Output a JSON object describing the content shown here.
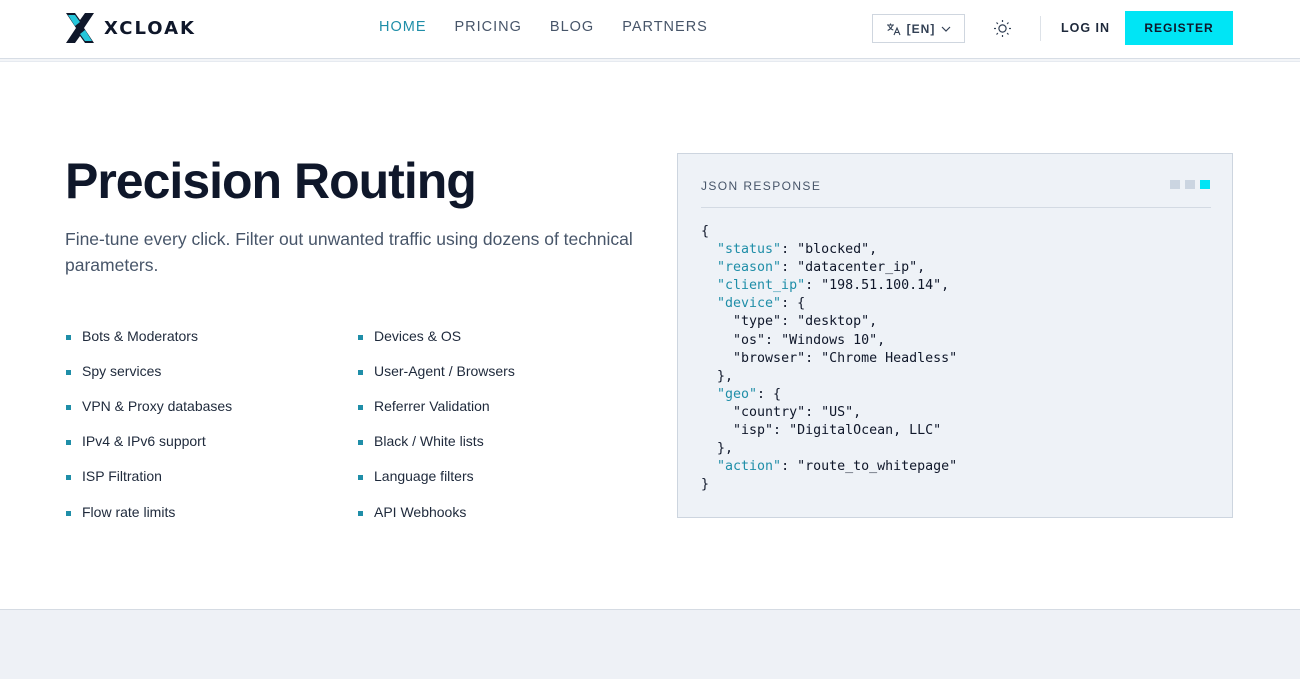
{
  "brand": {
    "name": "XCLOAK",
    "icon": "xcloak-logo-icon"
  },
  "nav": {
    "items": [
      {
        "label": "HOME",
        "active": true
      },
      {
        "label": "PRICING",
        "active": false
      },
      {
        "label": "BLOG",
        "active": false
      },
      {
        "label": "PARTNERS",
        "active": false
      }
    ]
  },
  "header": {
    "language_label": "[EN]",
    "language_icon": "translate-icon",
    "theme_icon": "sun-icon",
    "login_label": "LOG IN",
    "register_label": "REGISTER"
  },
  "hero": {
    "title": "Precision Routing",
    "subtitle": "Fine-tune every click. Filter out unwanted traffic using dozens of technical parameters."
  },
  "features": {
    "col1": [
      "Bots & Moderators",
      "Spy services",
      "VPN & Proxy databases",
      "IPv4 & IPv6 support",
      "ISP Filtration",
      "Flow rate limits"
    ],
    "col2": [
      "Devices & OS",
      "User-Agent / Browsers",
      "Referrer Validation",
      "Black / White lists",
      "Language filters",
      "API Webhooks"
    ]
  },
  "json_panel": {
    "title": "JSON RESPONSE",
    "lines": [
      {
        "indent": 0,
        "key": "",
        "rest": "{"
      },
      {
        "indent": 1,
        "key": "status",
        "rest": ": \"blocked\","
      },
      {
        "indent": 1,
        "key": "reason",
        "rest": ": \"datacenter_ip\","
      },
      {
        "indent": 1,
        "key": "client_ip",
        "rest": ": \"198.51.100.14\","
      },
      {
        "indent": 1,
        "key": "device",
        "rest": ": {"
      },
      {
        "indent": 2,
        "key": "",
        "rest": "\"type\": \"desktop\","
      },
      {
        "indent": 2,
        "key": "",
        "rest": "\"os\": \"Windows 10\","
      },
      {
        "indent": 2,
        "key": "",
        "rest": "\"browser\": \"Chrome Headless\""
      },
      {
        "indent": 1,
        "key": "",
        "rest": "},"
      },
      {
        "indent": 1,
        "key": "geo",
        "rest": ": {"
      },
      {
        "indent": 2,
        "key": "",
        "rest": "\"country\": \"US\","
      },
      {
        "indent": 2,
        "key": "",
        "rest": "\"isp\": \"DigitalOcean, LLC\""
      },
      {
        "indent": 1,
        "key": "",
        "rest": "},"
      },
      {
        "indent": 1,
        "key": "action",
        "rest": ": \"route_to_whitepage\""
      },
      {
        "indent": 0,
        "key": "",
        "rest": "}"
      }
    ]
  },
  "colors": {
    "accent": "#00e5f5",
    "link_active": "#1f8ea8",
    "json_key": "#1f8ea8"
  }
}
